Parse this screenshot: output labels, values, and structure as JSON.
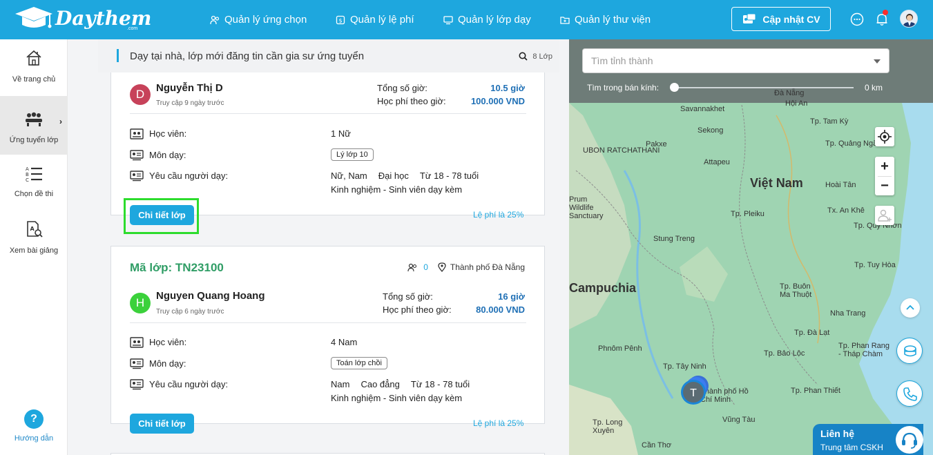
{
  "brand": {
    "name": "Daythem",
    "suffix": ".com"
  },
  "nav": [
    {
      "label": "Quản lý ứng chọn",
      "icon": "users-icon"
    },
    {
      "label": "Quản lý lệ phí",
      "icon": "dollar-icon"
    },
    {
      "label": "Quản lý lớp dạy",
      "icon": "monitor-icon"
    },
    {
      "label": "Quản lý thư viện",
      "icon": "folder-icon"
    }
  ],
  "topbar": {
    "cv_button": "Cập nhật CV"
  },
  "sidebar": {
    "items": [
      {
        "label": "Về trang chủ",
        "icon": "home-icon"
      },
      {
        "label": "Ứng tuyển lớp",
        "icon": "classroom-icon"
      },
      {
        "label": "Chọn đề thi",
        "icon": "abc-list-icon"
      },
      {
        "label": "Xem bài giảng",
        "icon": "document-search-icon"
      }
    ],
    "help": {
      "label": "Hướng dẫn",
      "glyph": "?"
    }
  },
  "list_header": {
    "title": "Dạy tại nhà, lớp mới đăng tin cần gia sư ứng tuyển",
    "count": "8 Lớp"
  },
  "labels": {
    "total_hours": "Tổng số giờ:",
    "fee_per_hour": "Học phí theo giờ:",
    "student": "Học viên:",
    "subject": "Môn dạy:",
    "requirement": "Yêu cầu người dạy:",
    "detail_button": "Chi tiết lớp",
    "fee_note": "Lệ phí là 25%"
  },
  "cards": [
    {
      "initial": "D",
      "avatar_color": "#c7425a",
      "teacher": "Nguyễn Thị D",
      "last_access": "Truy cập 9 ngày trước",
      "total_hours": "10.5 giờ",
      "fee_per_hour": "100.000 VND",
      "student": "1 Nữ",
      "subject": "Lý lớp 10",
      "req_gender": "Nữ, Nam",
      "req_level": "Đại học",
      "req_age": "Từ 18 - 78 tuổi",
      "req_exp": "Kinh nghiệm - Sinh viên dạy kèm"
    },
    {
      "code": "Mã lớp: TN23100",
      "applicants": "0",
      "location": "Thành phố Đà Nẵng",
      "initial": "H",
      "avatar_color": "#3bd13b",
      "teacher": "Nguyen Quang Hoang",
      "last_access": "Truy cập 6 ngày trước",
      "total_hours": "16 giờ",
      "fee_per_hour": "80.000 VND",
      "student": "4 Nam",
      "subject": "Toán lớp chồi",
      "req_gender": "Nam",
      "req_level": "Cao đẳng",
      "req_age": "Từ 18 - 78 tuổi",
      "req_exp": "Kinh nghiệm - Sinh viên dạy kèm"
    }
  ],
  "map": {
    "province_placeholder": "Tìm tỉnh thành",
    "radius_label": "Tìm trong bán kính:",
    "radius_value": "0 km",
    "marker_initial": "T",
    "zoom_in": "+",
    "zoom_out": "−",
    "places": [
      "Đà Nẵng",
      "Hội An",
      "Savannakhet",
      "Sekong",
      "Tp. Tam Kỳ",
      "Tp. Quảng Ngãi",
      "Pakxe",
      "UBON RATCHATHANI",
      "Attapeu",
      "Việt Nam",
      "Hoài Tân",
      "Tx. An Khê",
      "Tp. Pleiku",
      "Tp. Quy Nhơn",
      "Stung Treng",
      "Campuchia",
      "Tp. Tuy Hòa",
      "Tp. Buôn Ma Thuột",
      "Nha Trang",
      "Tp. Đà Lạt",
      "Phnôm Pênh",
      "Tp. Tây Ninh",
      "Tp. Bảo Lộc",
      "Tp. Phan Rang - Tháp Chàm",
      "Tp. Phan Thiết",
      "Thành phố Hồ Chí Minh",
      "Vũng Tàu",
      "Tp. Long Xuyên",
      "Cần Thơ",
      "Prum Wildlife Sanctuary"
    ]
  },
  "contact": {
    "title": "Liên hệ",
    "subtitle": "Trung tâm CSKH"
  },
  "colors": {
    "primary": "#1ea7de",
    "green_code": "#2f9d65",
    "value_blue": "#1e6fb5",
    "highlight": "#2ddc2d"
  }
}
